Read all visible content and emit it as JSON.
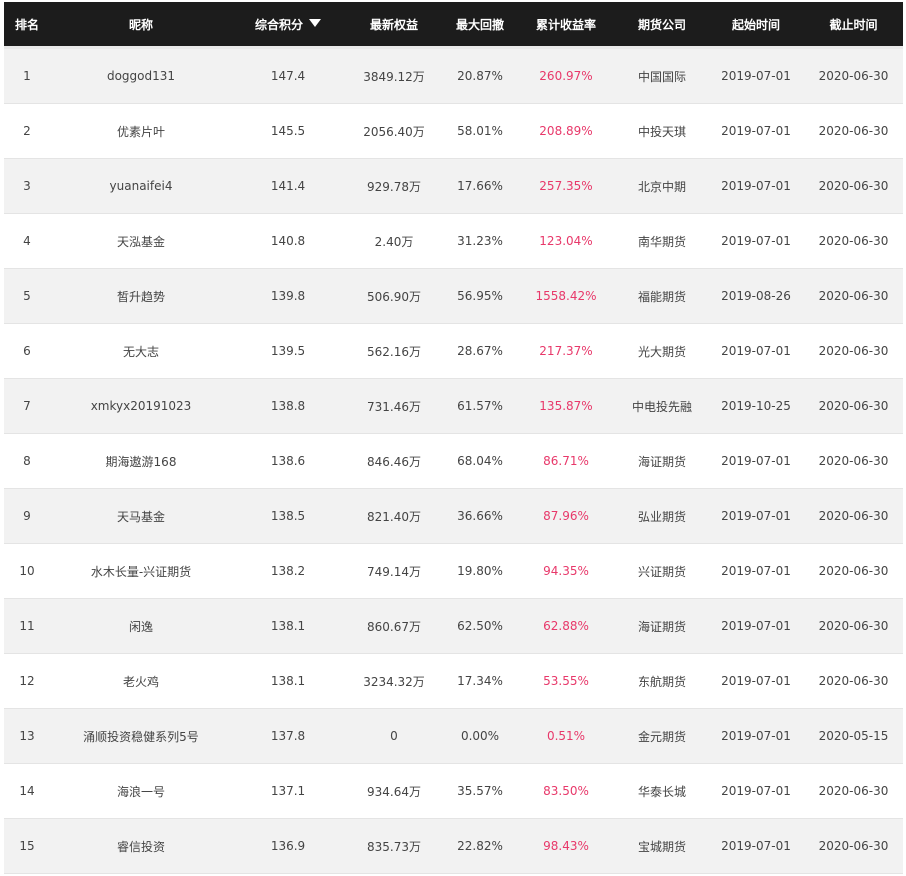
{
  "columns": {
    "rank": "排名",
    "nickname": "昵称",
    "score": "综合积分",
    "equity": "最新权益",
    "drawdown": "最大回撤",
    "cum_return": "累计收益率",
    "company": "期货公司",
    "start": "起始时间",
    "end": "截止时间"
  },
  "sort_icon": "sort-descending-icon",
  "colors": {
    "header_bg": "#1c1c1c",
    "return_text": "#e8386a",
    "row_alt": "#f2f2f2"
  },
  "rows": [
    {
      "rank": "1",
      "nickname": "doggod131",
      "score": "147.4",
      "equity": "3849.12万",
      "drawdown": "20.87%",
      "cum_return": "260.97%",
      "company": "中国国际",
      "start": "2019-07-01",
      "end": "2020-06-30"
    },
    {
      "rank": "2",
      "nickname": "优素片叶",
      "score": "145.5",
      "equity": "2056.40万",
      "drawdown": "58.01%",
      "cum_return": "208.89%",
      "company": "中投天琪",
      "start": "2019-07-01",
      "end": "2020-06-30"
    },
    {
      "rank": "3",
      "nickname": "yuanaifei4",
      "score": "141.4",
      "equity": "929.78万",
      "drawdown": "17.66%",
      "cum_return": "257.35%",
      "company": "北京中期",
      "start": "2019-07-01",
      "end": "2020-06-30"
    },
    {
      "rank": "4",
      "nickname": "天泓基金",
      "score": "140.8",
      "equity": "2.40万",
      "drawdown": "31.23%",
      "cum_return": "123.04%",
      "company": "南华期货",
      "start": "2019-07-01",
      "end": "2020-06-30"
    },
    {
      "rank": "5",
      "nickname": "皙升趋势",
      "score": "139.8",
      "equity": "506.90万",
      "drawdown": "56.95%",
      "cum_return": "1558.42%",
      "company": "福能期货",
      "start": "2019-08-26",
      "end": "2020-06-30"
    },
    {
      "rank": "6",
      "nickname": "无大志",
      "score": "139.5",
      "equity": "562.16万",
      "drawdown": "28.67%",
      "cum_return": "217.37%",
      "company": "光大期货",
      "start": "2019-07-01",
      "end": "2020-06-30"
    },
    {
      "rank": "7",
      "nickname": "xmkyx20191023",
      "score": "138.8",
      "equity": "731.46万",
      "drawdown": "61.57%",
      "cum_return": "135.87%",
      "company": "中电投先融",
      "start": "2019-10-25",
      "end": "2020-06-30"
    },
    {
      "rank": "8",
      "nickname": "期海遨游168",
      "score": "138.6",
      "equity": "846.46万",
      "drawdown": "68.04%",
      "cum_return": "86.71%",
      "company": "海证期货",
      "start": "2019-07-01",
      "end": "2020-06-30"
    },
    {
      "rank": "9",
      "nickname": "天马基金",
      "score": "138.5",
      "equity": "821.40万",
      "drawdown": "36.66%",
      "cum_return": "87.96%",
      "company": "弘业期货",
      "start": "2019-07-01",
      "end": "2020-06-30"
    },
    {
      "rank": "10",
      "nickname": "水木长量-兴证期货",
      "score": "138.2",
      "equity": "749.14万",
      "drawdown": "19.80%",
      "cum_return": "94.35%",
      "company": "兴证期货",
      "start": "2019-07-01",
      "end": "2020-06-30"
    },
    {
      "rank": "11",
      "nickname": "闲逸",
      "score": "138.1",
      "equity": "860.67万",
      "drawdown": "62.50%",
      "cum_return": "62.88%",
      "company": "海证期货",
      "start": "2019-07-01",
      "end": "2020-06-30"
    },
    {
      "rank": "12",
      "nickname": "老火鸡",
      "score": "138.1",
      "equity": "3234.32万",
      "drawdown": "17.34%",
      "cum_return": "53.55%",
      "company": "东航期货",
      "start": "2019-07-01",
      "end": "2020-06-30"
    },
    {
      "rank": "13",
      "nickname": "涌顺投资稳健系列5号",
      "score": "137.8",
      "equity": "0",
      "drawdown": "0.00%",
      "cum_return": "0.51%",
      "company": "金元期货",
      "start": "2019-07-01",
      "end": "2020-05-15"
    },
    {
      "rank": "14",
      "nickname": "海浪一号",
      "score": "137.1",
      "equity": "934.64万",
      "drawdown": "35.57%",
      "cum_return": "83.50%",
      "company": "华泰长城",
      "start": "2019-07-01",
      "end": "2020-06-30"
    },
    {
      "rank": "15",
      "nickname": "睿信投资",
      "score": "136.9",
      "equity": "835.73万",
      "drawdown": "22.82%",
      "cum_return": "98.43%",
      "company": "宝城期货",
      "start": "2019-07-01",
      "end": "2020-06-30"
    }
  ]
}
